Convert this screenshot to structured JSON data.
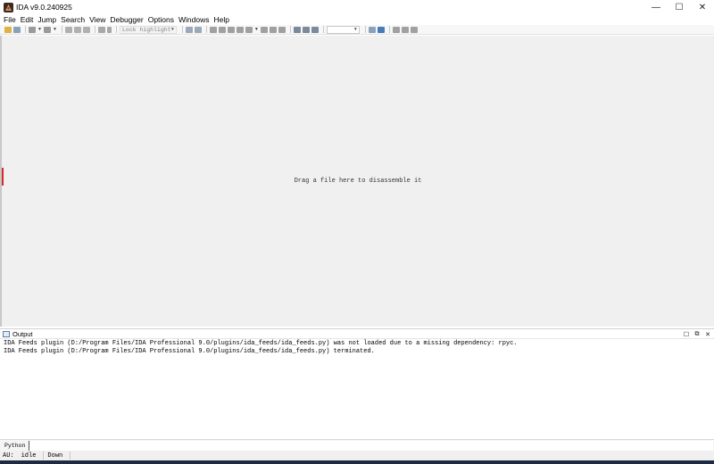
{
  "window": {
    "title": "IDA v9.0.240925",
    "minimize_glyph": "—",
    "maximize_glyph": "☐",
    "close_glyph": "✕"
  },
  "menu": [
    "File",
    "Edit",
    "Jump",
    "Search",
    "View",
    "Debugger",
    "Options",
    "Windows",
    "Help"
  ],
  "toolbar": {
    "lock_highlight_label": "Lock highlight",
    "debugger_combo_value": ""
  },
  "workspace": {
    "drop_hint": "Drag a file here to disassemble it"
  },
  "output": {
    "title": "Output",
    "lines": [
      "IDA Feeds plugin (D:/Program Files/IDA Professional 9.0/plugins/ida_feeds/ida_feeds.py) was not loaded due to a missing dependency: rpyc.",
      "IDA Feeds plugin (D:/Program Files/IDA Professional 9.0/plugins/ida_feeds/ida_feeds.py) terminated."
    ]
  },
  "cmdline": {
    "language": "Python",
    "value": ""
  },
  "status": {
    "au_label": "AU:",
    "au_state": "idle",
    "direction": "Down"
  },
  "colors": {
    "workspace_bg": "#f0f0f0",
    "accent_edge": "#d62a2a"
  }
}
